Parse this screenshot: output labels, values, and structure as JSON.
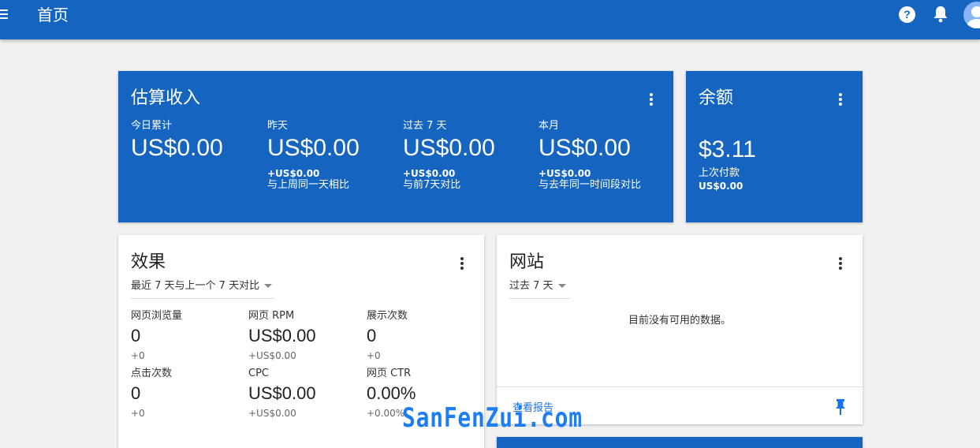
{
  "header": {
    "title": "首页",
    "help": "?"
  },
  "earnings": {
    "title": "估算收入",
    "metrics": [
      {
        "label": "今日累计",
        "value": "US$0.00",
        "delta": "",
        "compare": ""
      },
      {
        "label": "昨天",
        "value": "US$0.00",
        "delta": "+US$0.00",
        "compare": "与上周同一天相比"
      },
      {
        "label": "过去 7 天",
        "value": "US$0.00",
        "delta": "+US$0.00",
        "compare": "与前7天对比"
      },
      {
        "label": "本月",
        "value": "US$0.00",
        "delta": "+US$0.00",
        "compare": "与去年同一时间段对比"
      }
    ]
  },
  "balance": {
    "title": "余额",
    "value": "$3.11",
    "last_payment_label": "上次付款",
    "last_payment_value": "US$0.00"
  },
  "performance": {
    "title": "效果",
    "range": "最近 7 天与上一个 7 天对比",
    "metrics": [
      {
        "label": "网页浏览量",
        "value": "0",
        "delta": "+0"
      },
      {
        "label": "网页 RPM",
        "value": "US$0.00",
        "delta": "+US$0.00"
      },
      {
        "label": "展示次数",
        "value": "0",
        "delta": "+0"
      },
      {
        "label": "点击次数",
        "value": "0",
        "delta": "+0"
      },
      {
        "label": "CPC",
        "value": "US$0.00",
        "delta": "+US$0.00"
      },
      {
        "label": "网页 CTR",
        "value": "0.00%",
        "delta": "+0.00%"
      }
    ]
  },
  "sites": {
    "title": "网站",
    "range": "过去 7 天",
    "empty_message": "目前没有可用的数据。",
    "report_link": "查看报告"
  },
  "watermark": "SanFenZui.com",
  "colors": {
    "primary": "#1565c0",
    "link": "#1a73e8",
    "background": "#f1f1f1"
  },
  "icons": [
    "menu-icon",
    "help-icon",
    "bell-icon",
    "avatar-icon",
    "more-vert-icon",
    "pin-icon",
    "caret-down-icon"
  ]
}
